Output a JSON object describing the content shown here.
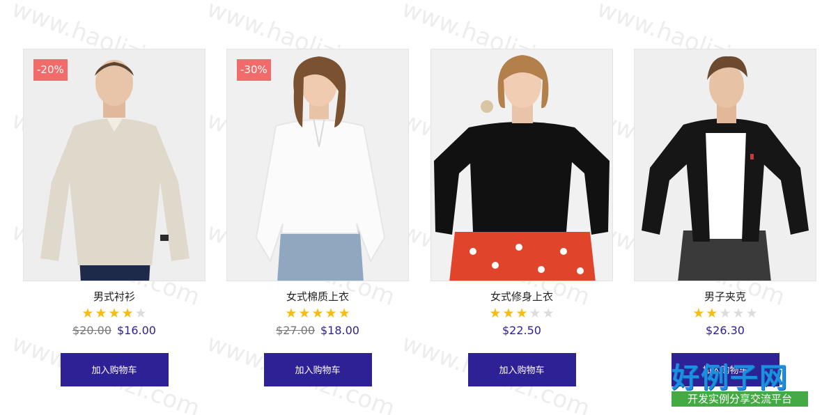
{
  "watermark_text": "www.haolizi.com",
  "products": [
    {
      "badge": "-20%",
      "name": "男式衬衫",
      "rating": 4,
      "rating_max": 5,
      "old_price": "$20.00",
      "price": "$16.00",
      "button_label": "加入购物车"
    },
    {
      "badge": "-30%",
      "name": "女式棉质上衣",
      "rating": 5,
      "rating_max": 5,
      "old_price": "$27.00",
      "price": "$18.00",
      "button_label": "加入购物车"
    },
    {
      "badge": "",
      "name": "女式修身上衣",
      "rating": 3,
      "rating_max": 5,
      "old_price": "",
      "price": "$22.50",
      "button_label": "加入购物车"
    },
    {
      "badge": "",
      "name": "男子夹克",
      "rating": 2,
      "rating_max": 5,
      "old_price": "",
      "price": "$26.30",
      "button_label": "加入购物车"
    }
  ],
  "logo": {
    "title": "好例子网",
    "subtitle": "开发实例分享交流平台"
  },
  "colors": {
    "accent": "#2e2196",
    "badge": "#f26b6b",
    "star": "#f5bd14",
    "star_empty": "#dcdcdc"
  }
}
